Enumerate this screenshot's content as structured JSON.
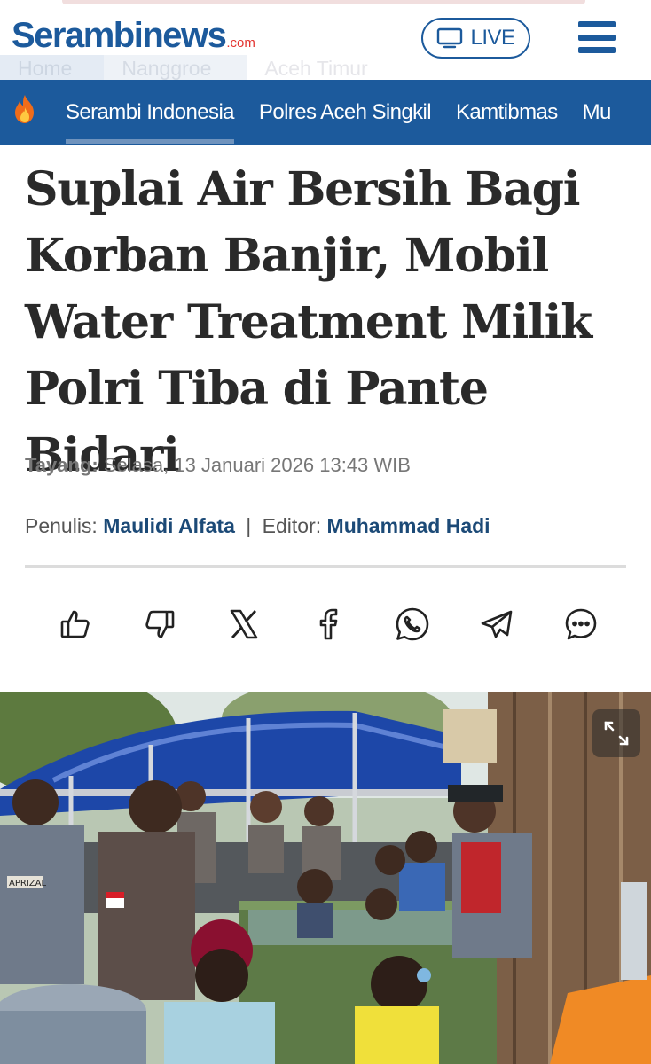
{
  "header": {
    "logo_text": "Serambinews",
    "logo_suffix": ".com",
    "live_label": "LIVE",
    "brand_color": "#1c5a9c"
  },
  "breadcrumb": [
    "Home",
    "Nanggroe",
    "Aceh Timur"
  ],
  "nav": {
    "items": [
      "Serambi Indonesia",
      "Polres Aceh Singkil",
      "Kamtibmas",
      "Mu"
    ],
    "active_index": 0
  },
  "article": {
    "title": "Suplai Air Bersih Bagi Korban Banjir, Mobil Water Treatment Milik Polri Tiba di Pante Bidari",
    "published_label": "Tayang:",
    "published_value": "Selasa, 13 Januari 2026 13:43 WIB",
    "author_label": "Penulis:",
    "author_name": "Maulidi Alfata",
    "editor_label": "Editor:",
    "editor_name": "Muhammad Hadi"
  },
  "share": {
    "icons": [
      "thumbs-up-icon",
      "thumbs-down-icon",
      "x-icon",
      "facebook-icon",
      "whatsapp-icon",
      "telegram-icon",
      "comment-icon"
    ]
  },
  "photo": {
    "badge_text": "APRIZAL"
  }
}
